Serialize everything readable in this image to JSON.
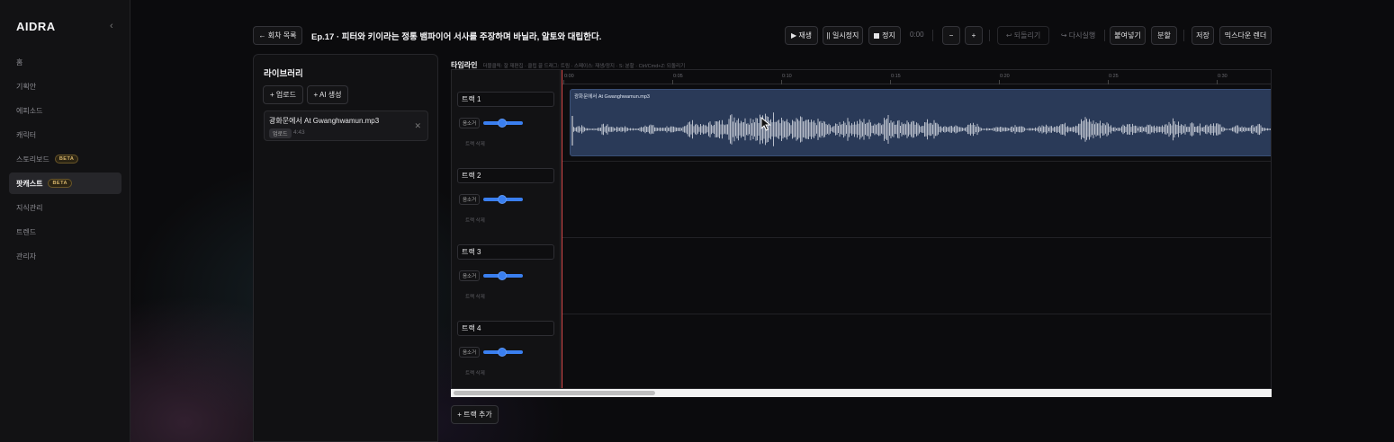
{
  "app": {
    "brand": "AIDRA",
    "collapse_icon": "‹"
  },
  "sidebar": {
    "items": [
      {
        "label": "홈"
      },
      {
        "label": "기획안"
      },
      {
        "label": "에피소드"
      },
      {
        "label": "캐릭터"
      },
      {
        "label": "스토리보드",
        "badge": "BETA"
      },
      {
        "label": "팟캐스트",
        "badge": "BETA",
        "active": true
      },
      {
        "label": "지식관리"
      },
      {
        "label": "트렌드"
      },
      {
        "label": "관리자"
      }
    ]
  },
  "toolbar": {
    "back_label": "← 회차 목록",
    "episode_title": "Ep.17 · 피터와 키이라는 정통 뱀파이어 서사를 주장하며 바닐라, 알토와 대립한다.",
    "play_label": "▶ 재생",
    "pause_label": "|| 일시정지",
    "stop_label": "정지",
    "time": "0:00",
    "zoom_out_label": "−",
    "zoom_in_label": "+",
    "undo_label": "↩ 되돌리기",
    "redo_label": "↪ 다시실행",
    "paste_label": "붙여넣기",
    "split_label": "분할",
    "save_label": "저장",
    "render_label": "믹스다운 렌더"
  },
  "library": {
    "title": "라이브러리",
    "upload_label": "+ 업로드",
    "ai_label": "+ AI 생성",
    "files": [
      {
        "name": "광화문에서 At Gwanghwamun.mp3",
        "tag": "업로드",
        "duration": "4:43"
      }
    ]
  },
  "timeline": {
    "title": "타임라인",
    "hint": "더블클릭: 잘 재편집 · 클립 끌 드래그: 트림 · 스페이스: 재생/정지 · S: 분할 · Ctrl/Cmd+Z: 되돌리기",
    "ticks": [
      "0:00",
      "0:05",
      "0:10",
      "0:15",
      "0:20",
      "0:25",
      "0:30"
    ],
    "tracks": [
      {
        "name": "트랙 1",
        "mute_label": "음소거",
        "delete_label": "트랙 삭제",
        "volume": 0.5
      },
      {
        "name": "트랙 2",
        "mute_label": "음소거",
        "delete_label": "트랙 삭제",
        "volume": 0.5
      },
      {
        "name": "트랙 3",
        "mute_label": "음소거",
        "delete_label": "트랙 삭제",
        "volume": 0.5
      },
      {
        "name": "트랙 4",
        "mute_label": "음소거",
        "delete_label": "트랙 삭제",
        "volume": 0.5
      }
    ],
    "clip": {
      "label": "광화문에서 At Gwanghwamun.mp3"
    },
    "add_track_label": "+ 트랙 추가"
  },
  "colors": {
    "accent": "#3a7ff0",
    "playhead": "#e05050",
    "clip": "#2a3a58",
    "beta": "#d6b46a"
  }
}
